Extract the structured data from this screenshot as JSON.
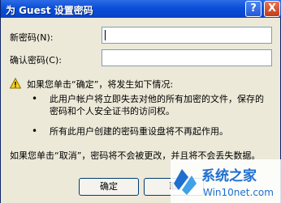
{
  "title": "为 Guest 设置密码",
  "titlebar_buttons": {
    "help": "?",
    "close": "X"
  },
  "fields": [
    {
      "label": "新密码(N):",
      "value": ""
    },
    {
      "label": "确认密码(C):",
      "value": ""
    }
  ],
  "warning": {
    "icon": "warning-icon",
    "heading": "如果您单击“确定”，将发生如下情况:",
    "bullets": [
      [
        "此用户帐户将立即失去对他的所有加密的文件，保存的",
        "密码和个人安全证书的访问权。"
      ],
      [
        "所有此用户创建的密码重设盘将不再起作用。"
      ]
    ]
  },
  "cancel_note": "如果您单击“取消”，密码将不会被更改，并且将不会丢失数据。",
  "buttons": {
    "ok": "确定",
    "cancel": "取"
  },
  "watermark": {
    "brand": "系统之家",
    "url": "Win10net.com"
  },
  "colors": {
    "titlebar": "#0A4FD8",
    "dialog_bg": "#ECE9D8",
    "close_button": "#C23B1A",
    "watermark_blue": "#1E6FD0"
  }
}
